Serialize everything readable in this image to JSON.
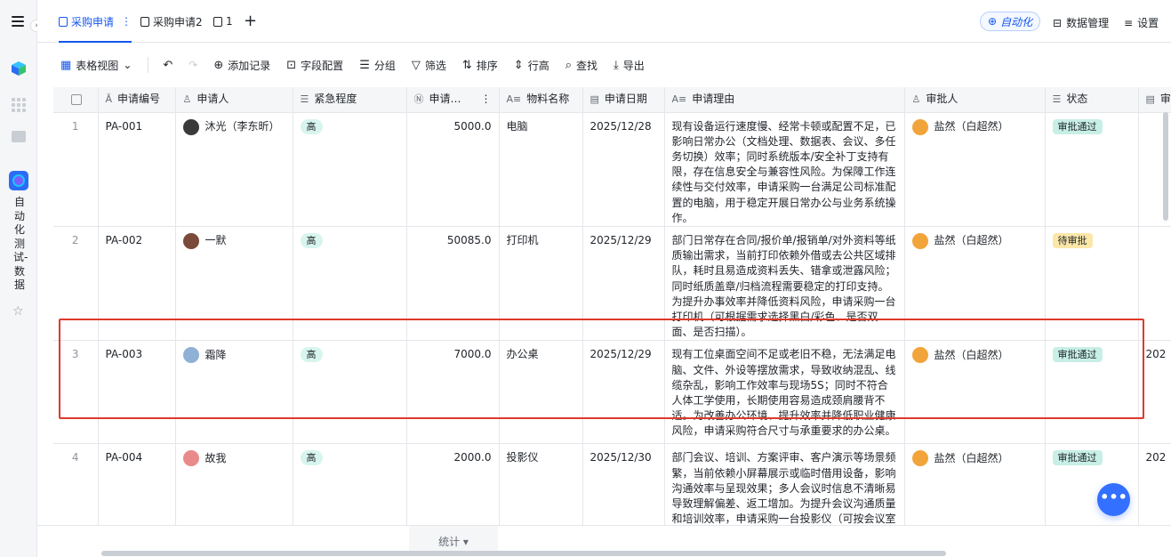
{
  "tabs": [
    {
      "label": "采购申请",
      "active": true
    },
    {
      "label": "采购申请2",
      "active": false
    },
    {
      "label": "1",
      "active": false
    }
  ],
  "topright": {
    "automation": "自动化",
    "data_manage": "数据管理",
    "settings": "设置"
  },
  "sidebar": {
    "app_name": "自动化测试-数据"
  },
  "toolbar": {
    "view": "表格视图",
    "add_record": "添加记录",
    "field_config": "字段配置",
    "group": "分组",
    "filter": "筛选",
    "sort": "排序",
    "row_height": "行高",
    "find": "查找",
    "export": "导出"
  },
  "columns": [
    "申请编号",
    "申请人",
    "紧急程度",
    "申请…",
    "物料名称",
    "申请日期",
    "申请理由",
    "审批人",
    "状态",
    "审"
  ],
  "rows": [
    {
      "idx": "1",
      "code": "PA-001",
      "applicant": "沐光（李东昕）",
      "urgency": "高",
      "amount": "5000.0",
      "item": "电脑",
      "date": "2025/12/28",
      "reason": "现有设备运行速度慢、经常卡顿或配置不足，已影响日常办公（文档处理、数据表、会议、多任务切换）效率；同时系统版本/安全补丁支持有限，存在信息安全与兼容性风险。为保障工作连续性与交付效率，申请采购一台满足公司标准配置的电脑，用于稳定开展日常办公与业务系统操作。",
      "approver": "盐然（白超然）",
      "status": "审批通过",
      "extra": ""
    },
    {
      "idx": "2",
      "code": "PA-002",
      "applicant": "一默",
      "urgency": "高",
      "amount": "50085.0",
      "item": "打印机",
      "date": "2025/12/29",
      "reason": "部门日常存在合同/报价单/报销单/对外资料等纸质输出需求，当前打印依赖外借或去公共区域排队，耗时且易造成资料丢失、错拿或泄露风险；同时纸质盖章/归档流程需要稳定的打印支持。为提升办事效率并降低资料风险，申请采购一台打印机（可根据需求选择黑白/彩色、是否双面、是否扫描）。",
      "approver": "盐然（白超然）",
      "status": "待审批",
      "extra": ""
    },
    {
      "idx": "3",
      "code": "PA-003",
      "applicant": "霜降",
      "urgency": "高",
      "amount": "7000.0",
      "item": "办公桌",
      "date": "2025/12/29",
      "reason": "现有工位桌面空间不足或老旧不稳，无法满足电脑、文件、外设等摆放需求，导致收纳混乱、线缆杂乱，影响工作效率与现场5S；同时不符合人体工学使用，长期使用容易造成颈肩腰背不适。为改善办公环境、提升效率并降低职业健康风险，申请采购符合尺寸与承重要求的办公桌。",
      "approver": "盐然（白超然）",
      "status": "审批通过",
      "extra": "202"
    },
    {
      "idx": "4",
      "code": "PA-004",
      "applicant": "故我",
      "urgency": "高",
      "amount": "2000.0",
      "item": "投影仪",
      "date": "2025/12/30",
      "reason": "部门会议、培训、方案评审、客户演示等场景频繁，当前依赖小屏幕展示或临时借用设备，影响沟通效率与呈现效果；多人会议时信息不清晰易导致理解偏差、返工增加。为提升会议沟通质量和培训效率，申请采购一台投影仪（可按会议室面积匹配亮度、分辨率及接口）。",
      "approver": "盐然（白超然）",
      "status": "审批通过",
      "extra": "202"
    }
  ],
  "footer": {
    "stat": "统计"
  },
  "colors": {
    "accent": "#1456f0",
    "highlight": "#e0392b",
    "chip": "#d8f5ed",
    "status_ok": "#c8efe6",
    "status_wait": "#fbe7a8"
  }
}
